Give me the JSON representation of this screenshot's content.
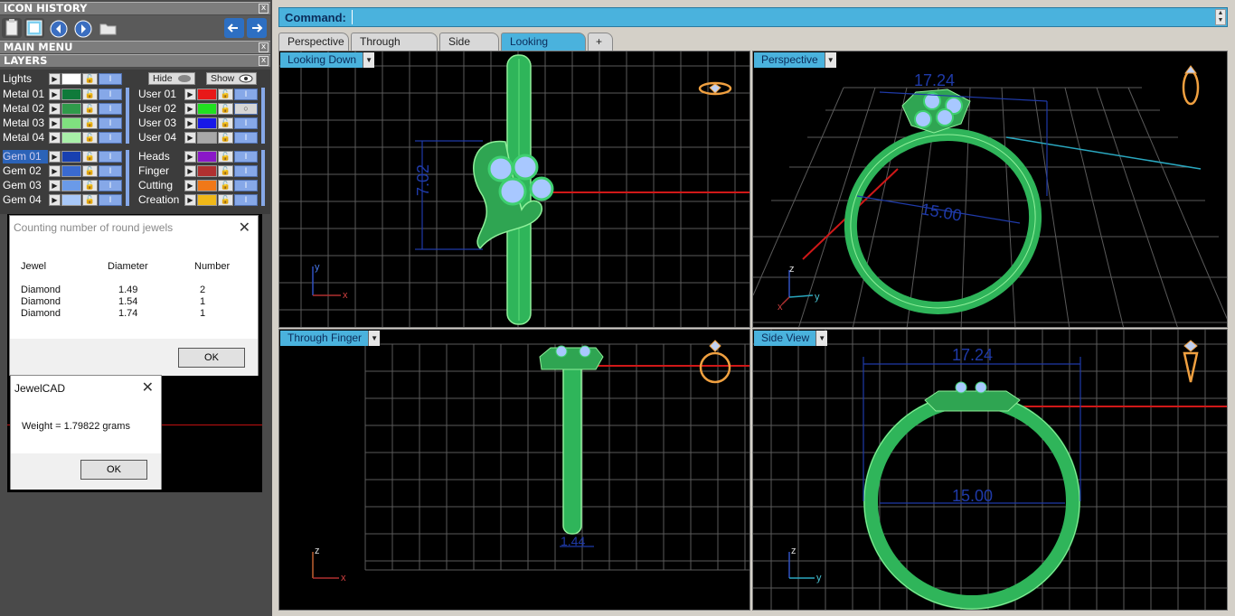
{
  "panels": {
    "icon_history": "ICON HISTORY",
    "main_menu": "MAIN MENU",
    "layers": "LAYERS",
    "close": "x"
  },
  "layers": {
    "lights": "Lights",
    "hide": "Hide",
    "show": "Show",
    "left": [
      {
        "name": "Metal 01",
        "color": "#0f7a3a"
      },
      {
        "name": "Metal 02",
        "color": "#2f9a4a"
      },
      {
        "name": "Metal 03",
        "color": "#7fe07f"
      },
      {
        "name": "Metal 04",
        "color": "#a8f0a8"
      },
      {
        "name": "Gem 01",
        "color": "#1840b0"
      },
      {
        "name": "Gem 02",
        "color": "#3a6ad0"
      },
      {
        "name": "Gem 03",
        "color": "#6a9ae8"
      },
      {
        "name": "Gem 04",
        "color": "#a8c8f8"
      }
    ],
    "right": [
      {
        "name": "User 01",
        "color": "#e81818"
      },
      {
        "name": "User 02",
        "color": "#20e020"
      },
      {
        "name": "User 03",
        "color": "#1818e8"
      },
      {
        "name": "User 04",
        "color": "#a8a8a8"
      },
      {
        "name": "Heads",
        "color": "#8a18c8"
      },
      {
        "name": "Finger",
        "color": "#b03030"
      },
      {
        "name": "Cutting",
        "color": "#f07818"
      },
      {
        "name": "Creation",
        "color": "#f0b818"
      }
    ]
  },
  "dialog_jewels": {
    "title": "Counting number of round jewels",
    "headers": [
      "Jewel",
      "Diameter",
      "Number"
    ],
    "rows": [
      [
        "Diamond",
        "1.49",
        "2"
      ],
      [
        "Diamond",
        "1.54",
        "1"
      ],
      [
        "Diamond",
        "1.74",
        "1"
      ]
    ],
    "ok": "OK"
  },
  "dialog_weight": {
    "title": "JewelCAD",
    "message": "Weight = 1.79822 grams",
    "ok": "OK"
  },
  "command": {
    "label": "Command:",
    "value": ""
  },
  "tabs": [
    "Perspective",
    "Through Finger",
    "Side View",
    "Looking Down",
    "+"
  ],
  "viewports": {
    "top_left": {
      "label": "Looking Down",
      "dims": [
        "7.02"
      ],
      "axes": [
        "y",
        "x"
      ]
    },
    "top_right": {
      "label": "Perspective",
      "dims": [
        "17.24",
        "15.00"
      ],
      "axes": [
        "z",
        "y",
        "x"
      ]
    },
    "bottom_left": {
      "label": "Through Finger",
      "dims": [
        "1.44"
      ],
      "axes": [
        "z",
        "x"
      ]
    },
    "bottom_right": {
      "label": "Side View",
      "dims": [
        "17.24",
        "15.00"
      ],
      "axes": [
        "z",
        "y"
      ]
    }
  },
  "colors": {
    "accent": "#4ab2dd",
    "ring_green": "#2fb55a",
    "gem_blue": "#a8c8ff",
    "dimension_blue": "#1f3aa8"
  }
}
